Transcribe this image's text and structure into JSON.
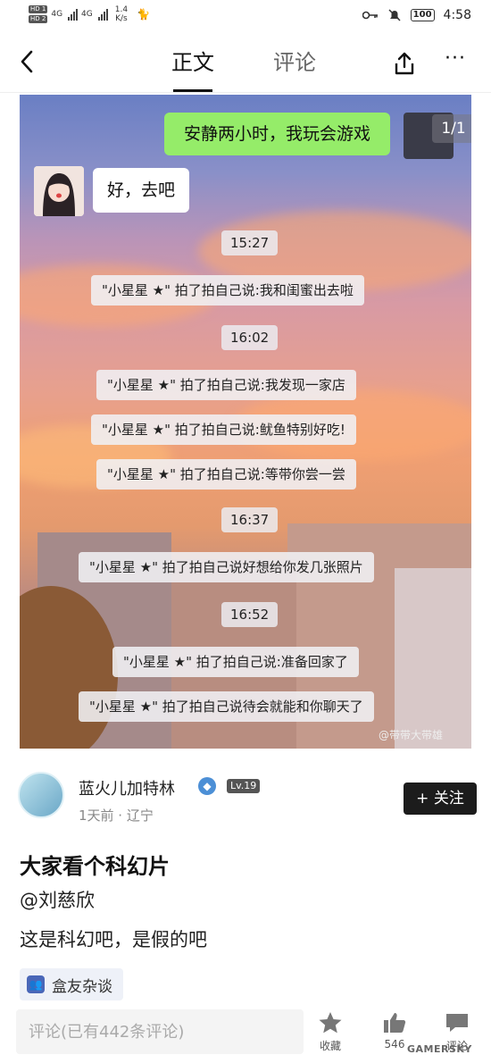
{
  "status_bar": {
    "hd1": "HD 1",
    "hd2": "HD 2",
    "net1": "4G",
    "net2": "4G",
    "speed": "1.4",
    "speed_unit": "K/s",
    "battery": "100",
    "time": "4:58"
  },
  "nav": {
    "tab_main": "正文",
    "tab_comments": "评论",
    "more": "···"
  },
  "image": {
    "page_counter": "1/1",
    "msg_self": "安静两小时，我玩会游戏",
    "msg_other": "好，去吧",
    "events": [
      {
        "time": "15:27"
      },
      {
        "text": "\"小星星 ★\" 拍了拍自己说:我和闺蜜出去啦"
      },
      {
        "time": "16:02"
      },
      {
        "text": "\"小星星 ★\" 拍了拍自己说:我发现一家店"
      },
      {
        "text": "\"小星星 ★\" 拍了拍自己说:鱿鱼特别好吃!"
      },
      {
        "text": "\"小星星 ★\" 拍了拍自己说:等带你尝一尝"
      },
      {
        "time": "16:37"
      },
      {
        "text": "\"小星星 ★\" 拍了拍自己说好想给你发几张照片"
      },
      {
        "time": "16:52"
      },
      {
        "text": "\"小星星 ★\" 拍了拍自己说:准备回家了"
      },
      {
        "text": "\"小星星 ★\" 拍了拍自己说待会就能和你聊天了"
      }
    ],
    "watermark": "@带带大带雄"
  },
  "author": {
    "name": "蓝火儿加特林",
    "level": "Lv.19",
    "meta": "1天前 · 辽宁",
    "follow_label": "+ 关注"
  },
  "post": {
    "title": "大家看个科幻片",
    "line1": "@刘慈欣",
    "line2": "这是科幻吧，是假的吧",
    "group": "盒友杂谈"
  },
  "bottom": {
    "comment_placeholder": "评论(已有442条评论)",
    "fav_label": "收藏",
    "like_label": "546",
    "comment_label": "评论"
  },
  "watermark_site": "GAMERSKY",
  "colors": {
    "bubble_green": "#95ec69",
    "follow_bg": "#1c1c1c",
    "group_icon": "#4a67b8"
  }
}
